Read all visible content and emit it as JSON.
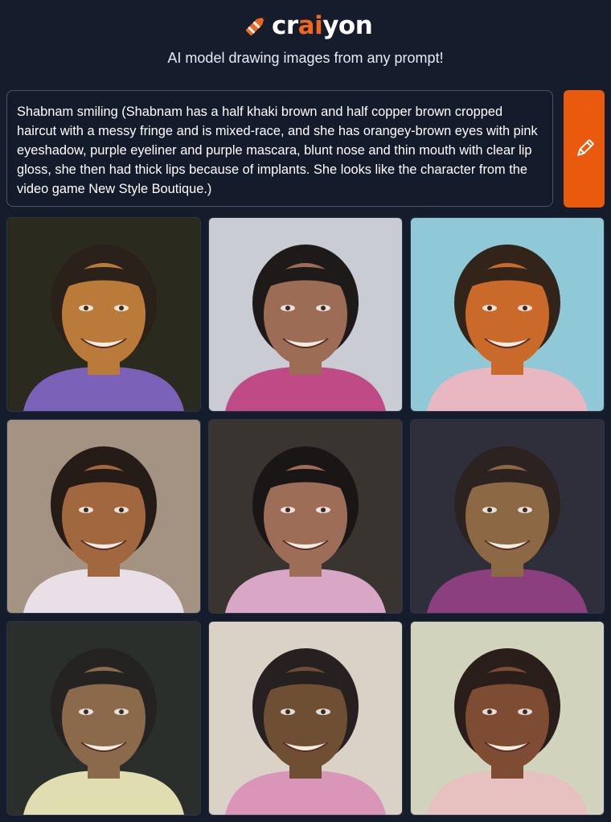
{
  "brand": {
    "name_part1": "cr",
    "name_part2": "ai",
    "name_part3": "yon",
    "tagline": "AI model drawing images from any prompt!",
    "accent_color": "#f0671f",
    "logo_icon": "crayon-icon"
  },
  "prompt": {
    "text": "Shabnam smiling (Shabnam has a half khaki brown and half copper brown cropped haircut with a messy fringe and is mixed-race, and she has orangey-brown eyes with pink eyeshadow, purple eyeliner and purple mascara, blunt nose and thin mouth with clear lip gloss, she then had thick lips because of implants. She looks like the character from the video game New Style Boutique.)"
  },
  "draw_button": {
    "icon": "pencil-icon",
    "color": "#ea5a0c"
  },
  "images": [
    {
      "bg": "#2b2a1e",
      "skin": "#b97a3a",
      "hair": "#2a211b",
      "shirt": "#7b62b8"
    },
    {
      "bg": "#c9ccd2",
      "skin": "#9c6c55",
      "hair": "#1f1a1a",
      "shirt": "#c04a86"
    },
    {
      "bg": "#8fc8d6",
      "skin": "#c9692a",
      "hair": "#332419",
      "shirt": "#e8b7c2"
    },
    {
      "bg": "#a49382",
      "skin": "#a1673f",
      "hair": "#251b17",
      "shirt": "#e8e0e6"
    },
    {
      "bg": "#3a3431",
      "skin": "#9d6d57",
      "hair": "#1a1616",
      "shirt": "#d9a7c6"
    },
    {
      "bg": "#2e2f3a",
      "skin": "#8d6844",
      "hair": "#2c2320",
      "shirt": "#8c3f7e"
    },
    {
      "bg": "#2a2f2b",
      "skin": "#8a6a4a",
      "hair": "#252321",
      "shirt": "#e0ddb0"
    },
    {
      "bg": "#dad2c6",
      "skin": "#6f4f34",
      "hair": "#262120",
      "shirt": "#d996b8"
    },
    {
      "bg": "#d2d3bc",
      "skin": "#7d4c33",
      "hair": "#2a1e1a",
      "shirt": "#e7c1c0"
    }
  ]
}
